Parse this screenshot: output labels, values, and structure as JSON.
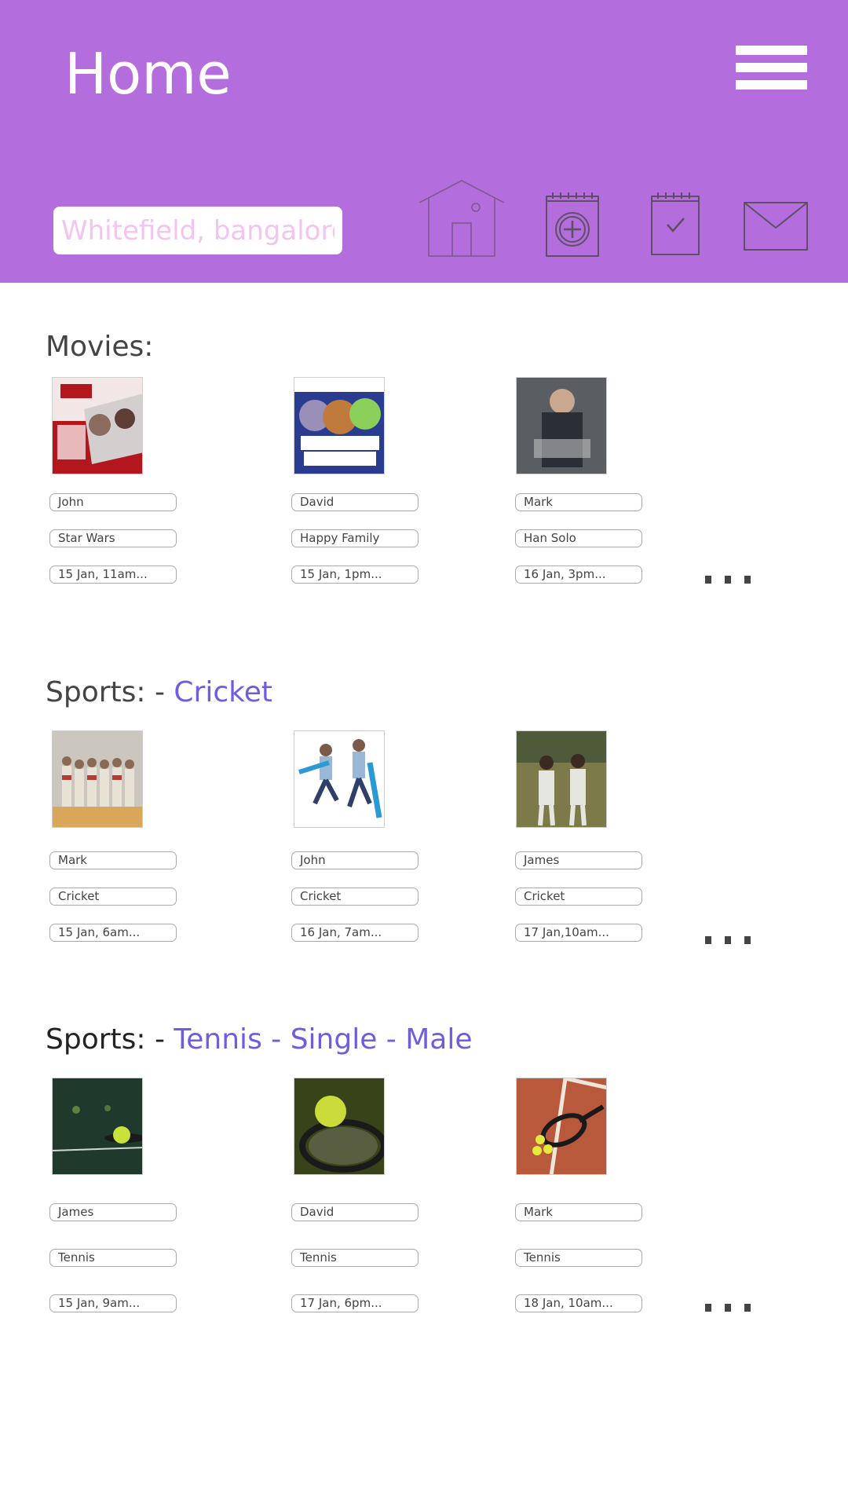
{
  "header": {
    "title": "Home",
    "location_value": "Whitefield, bangalore",
    "menu_icon": "hamburger-menu-icon",
    "nav_icons": [
      "home-icon",
      "calendar-add-icon",
      "calendar-check-icon",
      "mail-icon"
    ],
    "background_color": "#b36ddc"
  },
  "sections": [
    {
      "title": "Movies:",
      "accent": "",
      "cards": [
        {
          "image": "star-wars-poster",
          "name": "John",
          "event": "Star Wars",
          "time": "15 Jan, 11am..."
        },
        {
          "image": "happy-family-poster",
          "name": "David",
          "event": "Happy Family",
          "time": "15 Jan, 1pm..."
        },
        {
          "image": "han-solo-poster",
          "name": "Mark",
          "event": "Han Solo",
          "time": "16 Jan, 3pm..."
        }
      ]
    },
    {
      "title": "Sports: - ",
      "accent": "Cricket",
      "cards": [
        {
          "image": "cricket-team-photo",
          "name": "Mark",
          "event": "Cricket",
          "time": "15 Jan, 6am..."
        },
        {
          "image": "cricket-players-running",
          "name": "John",
          "event": "Cricket",
          "time": "16 Jan, 7am..."
        },
        {
          "image": "cricket-boys-photo",
          "name": "James",
          "event": "Cricket",
          "time": "17 Jan,10am..."
        }
      ]
    },
    {
      "title": "Sports: - ",
      "accent": "Tennis - Single - Male",
      "cards": [
        {
          "image": "tennis-ball-racket",
          "name": "James",
          "event": "Tennis",
          "time": "15 Jan, 9am..."
        },
        {
          "image": "tennis-ball-on-racket",
          "name": "David",
          "event": "Tennis",
          "time": "17 Jan, 6pm..."
        },
        {
          "image": "tennis-court-racket",
          "name": "Mark",
          "event": "Tennis",
          "time": "18 Jan, 10am..."
        }
      ]
    }
  ],
  "more_icon": "more-dots-icon",
  "accent_color": "#6f5de0"
}
